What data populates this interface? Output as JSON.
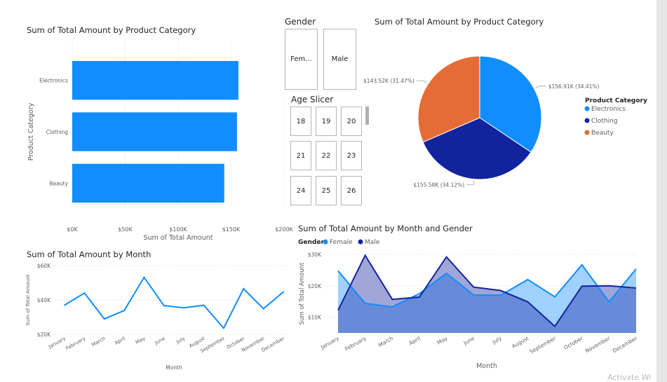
{
  "colors": {
    "electronics": "#118dff",
    "clothing": "#12239e",
    "beauty": "#e66c37",
    "bar": "#118dff",
    "female": "#118dff",
    "male": "#12239e",
    "grid": "#d6d6d6"
  },
  "gender_slicer": {
    "title": "Gender",
    "options": [
      "Fem...",
      "Male"
    ]
  },
  "age_slicer": {
    "title": "Age Slicer",
    "options": [
      "18",
      "19",
      "20",
      "21",
      "22",
      "23",
      "24",
      "25",
      "26"
    ]
  },
  "chart_data": [
    {
      "id": "bar_by_category",
      "type": "bar",
      "orientation": "horizontal",
      "title": "Sum of Total Amount by Product Category",
      "xlabel": "Sum of Total Amount",
      "ylabel": "Product Category",
      "categories": [
        "Electronics",
        "Clothing",
        "Beauty"
      ],
      "values": [
        156905,
        155580,
        143515
      ],
      "xlim": [
        0,
        200000
      ],
      "xticks": [
        "$0K",
        "$50K",
        "$100K",
        "$150K",
        "$200K"
      ],
      "grid": true
    },
    {
      "id": "pie_by_category",
      "type": "pie",
      "title": "Sum of Total Amount by Product Category",
      "legend_title": "Product Category",
      "legend_position": "right",
      "categories": [
        "Electronics",
        "Clothing",
        "Beauty"
      ],
      "values": [
        156910,
        155580,
        143520
      ],
      "percents": [
        34.41,
        34.12,
        31.47
      ],
      "data_labels": [
        "$156.91K (34.41%)",
        "$155.58K (34.12%)",
        "$143.52K (31.47%)"
      ]
    },
    {
      "id": "line_by_month",
      "type": "line",
      "title": "Sum of Total Amount by Month",
      "xlabel": "Month",
      "ylabel": "Sum of Total Amount",
      "x": [
        "January",
        "February",
        "March",
        "April",
        "May",
        "June",
        "July",
        "August",
        "September",
        "October",
        "November",
        "December"
      ],
      "values": [
        36980,
        44060,
        28990,
        33870,
        53150,
        36715,
        35465,
        36960,
        23620,
        46580,
        34920,
        44690
      ],
      "ylim": [
        20000,
        60000
      ],
      "yticks": [
        "$20K",
        "$40K",
        "$60K"
      ],
      "grid": true
    },
    {
      "id": "area_by_month_gender",
      "type": "area",
      "title": "Sum of Total Amount by Month and Gender",
      "xlabel": "Month",
      "ylabel": "Sum of Total Amount",
      "legend_title": "Gender",
      "legend_position": "top-left",
      "x": [
        "January",
        "February",
        "March",
        "April",
        "May",
        "June",
        "July",
        "August",
        "September",
        "October",
        "November",
        "December"
      ],
      "series": [
        {
          "name": "Female",
          "values": [
            24800,
            14400,
            13300,
            17500,
            24000,
            17100,
            17000,
            22000,
            16500,
            26700,
            14900,
            25400
          ]
        },
        {
          "name": "Male",
          "values": [
            12200,
            29700,
            15700,
            16400,
            29200,
            19600,
            18500,
            14900,
            7100,
            19900,
            20000,
            19300
          ]
        }
      ],
      "ylim": [
        5000,
        30000
      ],
      "yticks": [
        "$10K",
        "$20K",
        "$30K"
      ],
      "grid": true
    }
  ],
  "watermark": "Activate Wi"
}
